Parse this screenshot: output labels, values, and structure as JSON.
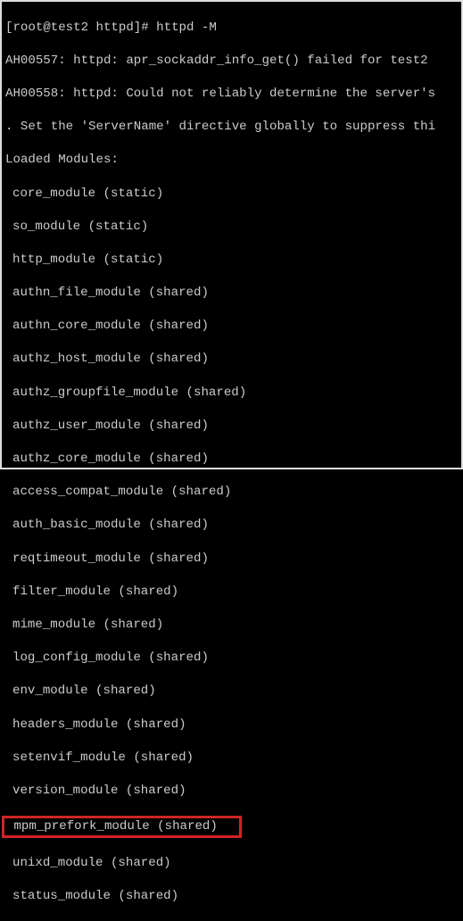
{
  "prompt": "[root@test2 httpd]# httpd -M",
  "err1": "AH00557: httpd: apr_sockaddr_info_get() failed for test2",
  "err2": "AH00558: httpd: Could not reliably determine the server's",
  "err3": ". Set the 'ServerName' directive globally to suppress thi",
  "header": "Loaded Modules:",
  "modules": {
    "m0": "core_module (static)",
    "m1": "so_module (static)",
    "m2": "http_module (static)",
    "m3": "authn_file_module (shared)",
    "m4": "authn_core_module (shared)",
    "m5": "authz_host_module (shared)",
    "m6": "authz_groupfile_module (shared)",
    "m7": "authz_user_module (shared)",
    "m8": "authz_core_module (shared)",
    "m9": "access_compat_module (shared)",
    "m10": "auth_basic_module (shared)",
    "m11": "reqtimeout_module (shared)",
    "m12": "filter_module (shared)",
    "m13": "mime_module (shared)",
    "m14": "log_config_module (shared)",
    "m15": "env_module (shared)",
    "m16": "headers_module (shared)",
    "m17": "setenvif_module (shared)",
    "m18": "version_module (shared)",
    "m19": "mpm_prefork_module (shared)",
    "m20": "unixd_module (shared)",
    "m21": "status_module (shared)"
  }
}
